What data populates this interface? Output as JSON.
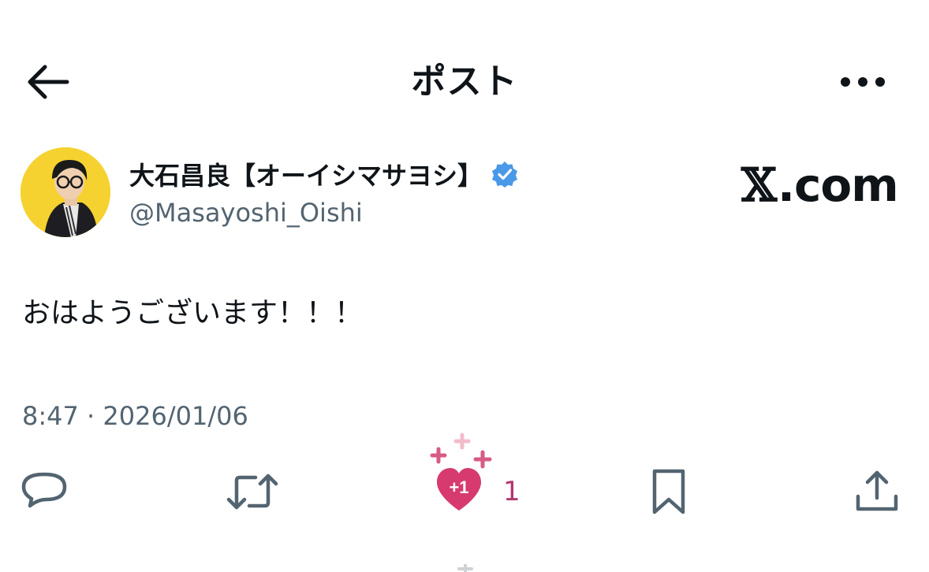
{
  "header": {
    "title": "ポスト",
    "back_icon": "arrow-left-icon",
    "more_icon": "ellipsis-icon"
  },
  "author": {
    "display_name": "大石昌良【オーイシマサヨシ】",
    "handle": "@Masayoshi_Oishi",
    "verified": true,
    "verified_color": "#4a99e9"
  },
  "site_logo": {
    "x": "𝕏",
    "text": ".com"
  },
  "post": {
    "text": "おはようございます！！！",
    "timestamp": "8:47 · 2026/01/06"
  },
  "actions": {
    "reply_icon": "reply-icon",
    "repost_icon": "repost-icon",
    "like_icon": "heart-plus-one-icon",
    "like_badge": "+1",
    "like_count": "1",
    "bookmark_icon": "bookmark-icon",
    "share_icon": "share-icon"
  },
  "colors": {
    "text": "#0f1419",
    "secondary": "#536471",
    "like": "#d73a6e",
    "like_count": "#b4356e",
    "avatar_bg": "#f5d230"
  }
}
